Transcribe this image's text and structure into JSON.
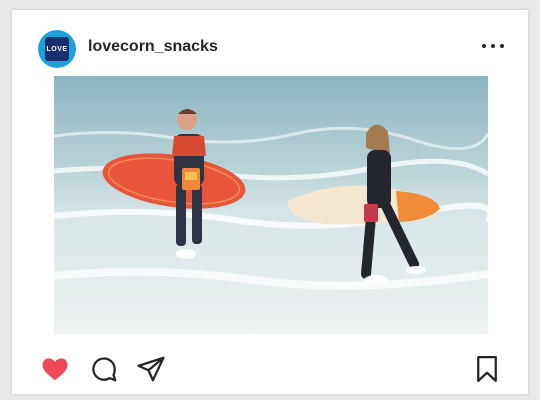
{
  "post": {
    "username": "lovecorn_snacks",
    "avatar_text": "LOVE CORN",
    "photo_description": "two surfers in wetsuits carrying surfboards and snack bags walking out of the ocean"
  },
  "icons": {
    "more": "more-options-icon",
    "like": "heart-icon",
    "comment": "comment-icon",
    "share": "send-icon",
    "save": "bookmark-icon"
  },
  "colors": {
    "like": "#ed4956",
    "text": "#262626",
    "avatar": "#1da3dc"
  }
}
